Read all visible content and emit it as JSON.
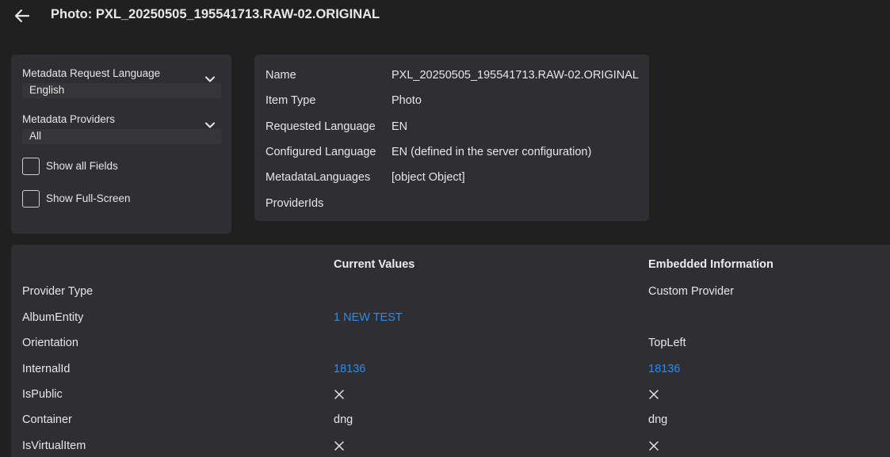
{
  "header": {
    "title": "Photo: PXL_20250505_195541713.RAW-02.ORIGINAL",
    "back_icon": "arrow-left-icon"
  },
  "options": {
    "language_select": {
      "label": "Metadata Request Language",
      "value": "English"
    },
    "providers_select": {
      "label": "Metadata Providers",
      "value": "All"
    },
    "show_all_fields": {
      "label": "Show all Fields",
      "checked": false
    },
    "show_full_screen": {
      "label": "Show Full-Screen",
      "checked": false
    }
  },
  "info": {
    "rows": [
      {
        "key": "Name",
        "value": "PXL_20250505_195541713.RAW-02.ORIGINAL"
      },
      {
        "key": "Item Type",
        "value": "Photo"
      },
      {
        "key": "Requested Language",
        "value": "EN"
      },
      {
        "key": "Configured Language",
        "value": "EN (defined in the server configuration)"
      },
      {
        "key": "MetadataLanguages",
        "value": "[object Object]"
      },
      {
        "key": "ProviderIds",
        "value": ""
      }
    ]
  },
  "fields": {
    "headers": {
      "field": "",
      "current": "Current Values",
      "embedded": "Embedded Information"
    },
    "rows": [
      {
        "name": "Provider Type",
        "current": "",
        "embedded": "Custom Provider"
      },
      {
        "name": "AlbumEntity",
        "current": "1 NEW TEST",
        "current_link": true,
        "embedded": ""
      },
      {
        "name": "Orientation",
        "current": "",
        "embedded": "TopLeft"
      },
      {
        "name": "InternalId",
        "current": "18136",
        "current_link": true,
        "embedded": "18136",
        "embedded_link": true
      },
      {
        "name": "IsPublic",
        "current": "×",
        "embedded": "×",
        "is_bool": true
      },
      {
        "name": "Container",
        "current": "dng",
        "embedded": "dng"
      },
      {
        "name": "IsVirtualItem",
        "current": "×",
        "embedded": "×",
        "is_bool": true
      }
    ]
  },
  "colors": {
    "background": "#202020",
    "panel": "#2f2f33",
    "link": "#2f8ae8",
    "text": "#e6e6e6"
  }
}
